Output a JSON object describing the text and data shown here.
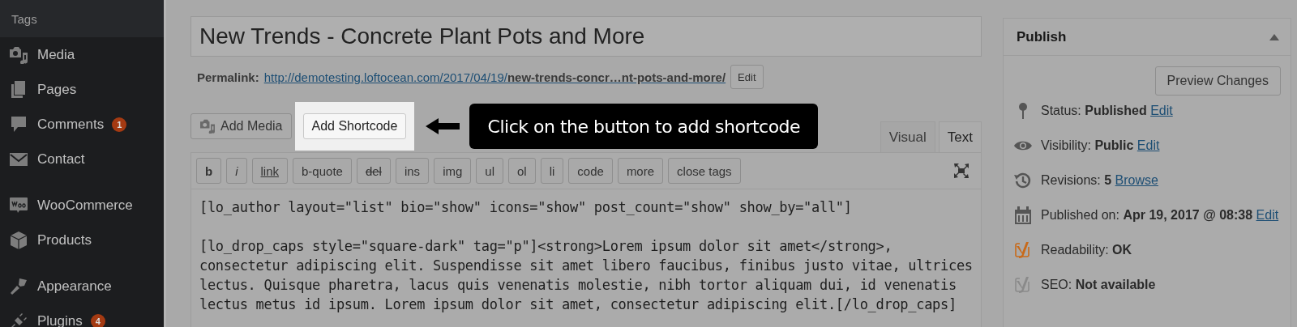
{
  "sidebar": {
    "header": "Tags",
    "groups": [
      [
        {
          "label": "Media"
        },
        {
          "label": "Pages"
        },
        {
          "label": "Comments",
          "badge": "1"
        },
        {
          "label": "Contact"
        }
      ],
      [
        {
          "label": "WooCommerce"
        },
        {
          "label": "Products"
        }
      ],
      [
        {
          "label": "Appearance"
        },
        {
          "label": "Plugins",
          "badge": "4"
        }
      ]
    ]
  },
  "editor": {
    "title": "New Trends - Concrete Plant Pots and More",
    "permalink": {
      "label": "Permalink:",
      "url": "http://demotesting.loftocean.com/2017/04/19/**new-trends-concr…nt-pots-and-more/**",
      "button": "Edit"
    },
    "media_buttons": [
      {
        "label": "Add Media",
        "highlighted": false
      },
      {
        "label": "Add Shortcode",
        "highlighted": true
      }
    ],
    "callout": "Click on the button to add shortcode",
    "tabs": [
      {
        "label": "Visual",
        "selected": false
      },
      {
        "label": "Text",
        "selected": true
      }
    ],
    "toolbar": [
      {
        "label": "b",
        "kind": "bold"
      },
      {
        "label": "i",
        "kind": "italic"
      },
      {
        "label": "link",
        "kind": "underline"
      },
      {
        "label": "b-quote",
        "kind": "plain"
      },
      {
        "label": "del",
        "kind": "strike"
      },
      {
        "label": "ins",
        "kind": "plain"
      },
      {
        "label": "img",
        "kind": "plain"
      },
      {
        "label": "ul",
        "kind": "plain"
      },
      {
        "label": "ol",
        "kind": "plain"
      },
      {
        "label": "li",
        "kind": "plain"
      },
      {
        "label": "code",
        "kind": "plain"
      },
      {
        "label": "more",
        "kind": "plain"
      },
      {
        "label": "close tags",
        "kind": "plain"
      }
    ],
    "content": [
      [
        "[lo_author layout=\"list\" bio=\"show\" icons=\"show\" post_count=\"show\" show_by=\"all\"]"
      ],
      [
        "[lo_drop_caps style=\"square-dark\" tag=\"p\"]<strong>Lorem ipsum dolor sit amet</strong>,",
        "consectetur adipiscing elit. Suspendisse sit amet libero faucibus, finibus justo vitae, ultrices",
        "lectus. Quisque pharetra, lacus quis venenatis molestie, nibh tortor aliquam dui, id venenatis",
        "lectus metus id ipsum. Lorem ipsum dolor sit amet, consectetur adipiscing elit.[/lo_drop_caps]"
      ]
    ]
  },
  "publish": {
    "title": "Publish",
    "preview_button": "Preview Changes",
    "rows": [
      {
        "text": "Status: **Published**",
        "link": "Edit"
      },
      {
        "text": "Visibility: **Public**",
        "link": "Edit"
      },
      {
        "text": "Revisions: **5**",
        "link": "Browse"
      },
      {
        "text": "Published on: **Apr 19, 2017 @ 08:38**",
        "link": "Edit"
      },
      {
        "text": "Readability: **OK**",
        "color": "#c86a1a"
      },
      {
        "text": "SEO: **Not available**",
        "color": "#8a8a8a"
      }
    ]
  }
}
